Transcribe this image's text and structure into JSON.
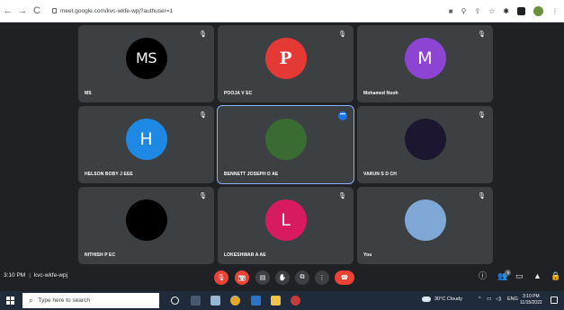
{
  "browser": {
    "url": "meet.google.com/kvc-wkfe-wpj?authuser=1",
    "nav_back": "←",
    "nav_forward": "→",
    "nav_reload": "C"
  },
  "tiles": [
    {
      "name": "MS",
      "avatar_text": "MS",
      "avatar_kind": "initials-black",
      "muted": true,
      "active": false
    },
    {
      "name": "POOJA V EC",
      "avatar_text": "P",
      "avatar_kind": "pinterest-red",
      "muted": true,
      "active": false
    },
    {
      "name": "Mohamed Nooh",
      "avatar_text": "M",
      "avatar_kind": "initial-purple",
      "muted": true,
      "active": false
    },
    {
      "name": "HELSON BOBY J EEE",
      "avatar_text": "H",
      "avatar_kind": "initial-blue",
      "muted": true,
      "active": false
    },
    {
      "name": "BENNETT JOSEPH D AE",
      "avatar_text": "",
      "avatar_kind": "photo",
      "muted": false,
      "active": true
    },
    {
      "name": "VARUN S D CH",
      "avatar_text": "",
      "avatar_kind": "art",
      "muted": true,
      "active": false
    },
    {
      "name": "NITHISH P EC",
      "avatar_text": "",
      "avatar_kind": "black",
      "muted": true,
      "active": false
    },
    {
      "name": "LOKESHWAR A AE",
      "avatar_text": "L",
      "avatar_kind": "initial-pink",
      "muted": true,
      "active": false
    },
    {
      "name": "You",
      "avatar_text": "",
      "avatar_kind": "photo-self",
      "muted": true,
      "active": false
    }
  ],
  "meeting": {
    "time": "3:10 PM",
    "separator": "|",
    "code": "kvc-wkfe-wpj",
    "participants_badge": "9"
  },
  "controls": [
    {
      "name": "mic-off-button",
      "icon": "mic-off-icon",
      "glyph": "🎙"
    },
    {
      "name": "camera-off-button",
      "icon": "camera-off-icon",
      "glyph": "📷"
    },
    {
      "name": "captions-button",
      "icon": "captions-icon",
      "glyph": "▤"
    },
    {
      "name": "raise-hand-button",
      "icon": "hand-icon",
      "glyph": "✋"
    },
    {
      "name": "present-button",
      "icon": "present-icon",
      "glyph": "⧉"
    },
    {
      "name": "more-options-button",
      "icon": "more-vert-icon",
      "glyph": "⋮"
    },
    {
      "name": "leave-call-button",
      "icon": "phone-hangup-icon",
      "glyph": "☎"
    }
  ],
  "taskbar": {
    "search_placeholder": "Type here to search",
    "weather": "30°C  Cloudy",
    "lang": "ENG",
    "clock_time": "3:10 PM",
    "clock_date": "11/15/2022"
  },
  "colors": {
    "meet_bg": "#202124",
    "tile_bg": "#3c4043",
    "accent_blue": "#1a73e8",
    "end_call_red": "#ea4335"
  }
}
